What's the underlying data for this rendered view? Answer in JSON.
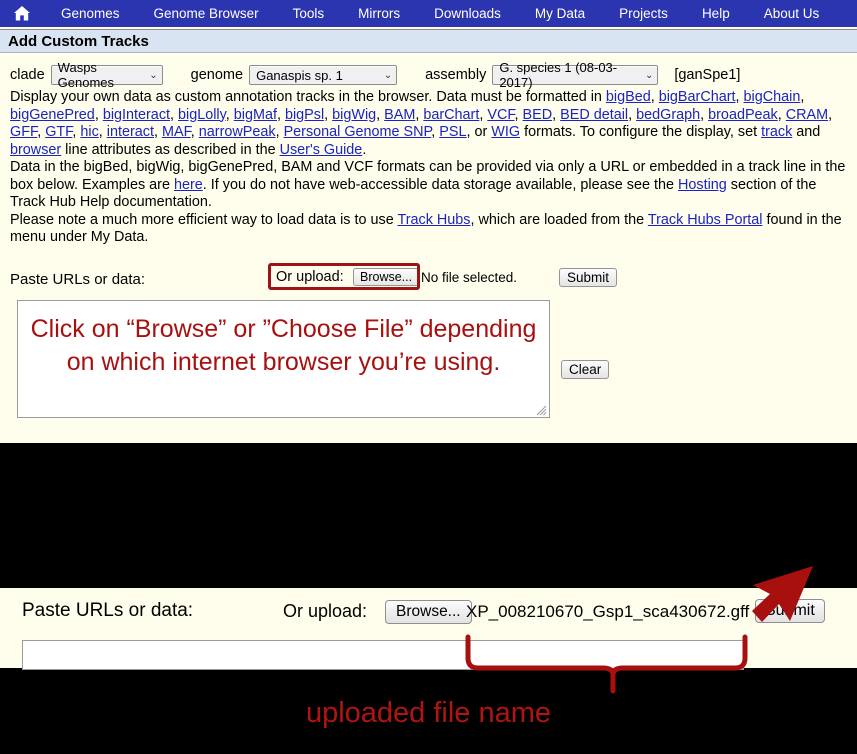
{
  "nav": {
    "home_icon": "home-icon",
    "items": [
      {
        "label": "Genomes"
      },
      {
        "label": "Genome Browser"
      },
      {
        "label": "Tools"
      },
      {
        "label": "Mirrors"
      },
      {
        "label": "Downloads"
      },
      {
        "label": "My Data"
      },
      {
        "label": "Projects"
      },
      {
        "label": "Help"
      },
      {
        "label": "About Us"
      }
    ]
  },
  "page": {
    "title": "Add Custom Tracks"
  },
  "selectors": {
    "clade_label": "clade",
    "clade_value": "Wasps Genomes",
    "genome_label": "genome",
    "genome_value": "Ganaspis sp. 1",
    "assembly_label": "assembly",
    "assembly_value": "G. species 1 (08-03-2017)",
    "assembly_tag": "[ganSpe1]",
    "chevron": "⌄"
  },
  "intro": {
    "t1": "Display your own data as custom annotation tracks in the browser. Data must be formatted in ",
    "formats": [
      "bigBed",
      "bigBarChart",
      "bigChain",
      "bigGenePred",
      "bigInteract",
      "bigLolly",
      "bigMaf",
      "bigPsl",
      "bigWig",
      "BAM",
      "barChart",
      "VCF",
      "BED",
      "BED detail",
      "bedGraph",
      "broadPeak",
      "CRAM",
      "GFF",
      "GTF",
      "hic",
      "interact",
      "MAF",
      "narrowPeak",
      "Personal Genome SNP",
      "PSL"
    ],
    "or_word": ", or ",
    "last_format": "WIG",
    "t2": " formats. To configure the display, set ",
    "link_track": "track",
    "t3": " and ",
    "link_browser": "browser",
    "t4": " line attributes as described in the ",
    "link_guide": "User's Guide",
    "t5": ".",
    "p2a": "Data in the bigBed, bigWig, bigGenePred, BAM and VCF formats can be provided via only a URL or embedded in a track line in the box below. Examples are ",
    "link_here": "here",
    "p2b": ". If you do not have web-accessible data storage available, please see the ",
    "link_hosting": "Hosting",
    "p2c": " section of the Track Hub Help documentation.",
    "p3a": "Please note a much more efficient way to load data is to use ",
    "link_trackhubs": "Track Hubs",
    "p3b": ", which are loaded from the ",
    "link_portal": "Track Hubs Portal",
    "p3c": " found in the menu under My Data."
  },
  "upload_top": {
    "paste_label": "Paste URLs or data:",
    "or_upload_label": "Or upload:",
    "browse_button": "Browse...",
    "no_file_text": "No file selected.",
    "submit_button": "Submit",
    "clear_button": "Clear",
    "textarea_value": "",
    "annotation": "Click on “Browse” or ”Choose File” depending on which internet browser you’re using."
  },
  "upload_bottom": {
    "paste_label": "Paste URLs or data:",
    "or_upload_label": "Or upload:",
    "browse_button": "Browse...",
    "file_name": "XP_008210670_Gsp1_sca430672.gff",
    "submit_button": "Submit",
    "textarea_value": "",
    "caption": "uploaded file name"
  },
  "colors": {
    "nav_blue": "#2b35af",
    "page_cream": "#fffeec",
    "title_bar": "#d9e4f2",
    "link_blue": "#1a23c4",
    "annotation_red": "#a81010",
    "highlight_red": "#9c1515",
    "arrow_red": "#a81010",
    "backdrop": "#000000"
  }
}
